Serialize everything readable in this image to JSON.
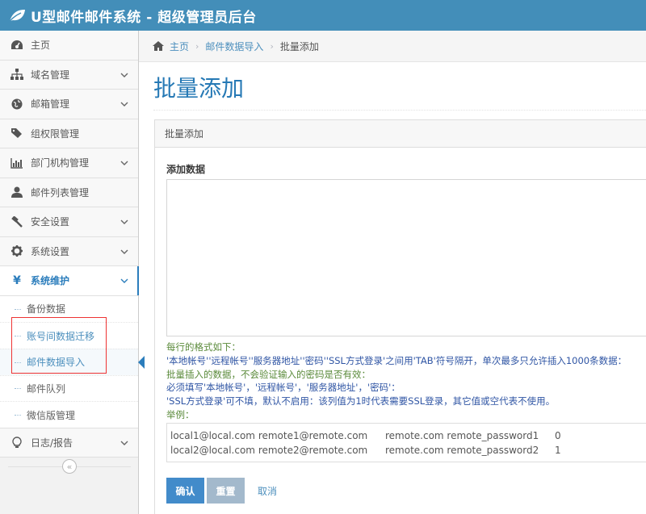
{
  "app": {
    "title": "U型邮件邮件系统 - 超级管理员后台"
  },
  "sidebar": {
    "items": [
      {
        "label": "主页",
        "icon": "dashboard-icon",
        "caret": false
      },
      {
        "label": "域名管理",
        "icon": "sitemap-icon",
        "caret": true
      },
      {
        "label": "邮箱管理",
        "icon": "globe-icon",
        "caret": true
      },
      {
        "label": "组权限管理",
        "icon": "tags-icon",
        "caret": false
      },
      {
        "label": "部门机构管理",
        "icon": "bar-chart-icon",
        "caret": true
      },
      {
        "label": "邮件列表管理",
        "icon": "user-icon",
        "caret": false
      },
      {
        "label": "安全设置",
        "icon": "gavel-icon",
        "caret": true
      },
      {
        "label": "系统设置",
        "icon": "cog-icon",
        "caret": true
      },
      {
        "label": "系统维护",
        "icon": "yen-icon",
        "caret": true,
        "active": true
      }
    ],
    "submenu": [
      {
        "label": "备份数据"
      },
      {
        "label": "账号间数据迁移",
        "highlight": true
      },
      {
        "label": "邮件数据导入",
        "highlight": true,
        "current": true
      },
      {
        "label": "邮件队列"
      },
      {
        "label": "微信版管理"
      }
    ],
    "last_item": {
      "label": "日志/报告",
      "icon": "lightbulb-icon",
      "caret": true
    },
    "collapse_glyph": "«"
  },
  "breadcrumb": {
    "home": "主页",
    "parent": "邮件数据导入",
    "current": "批量添加",
    "sep": "›"
  },
  "page": {
    "title": "批量添加"
  },
  "widget": {
    "header": "批量添加",
    "field_label": "添加数据",
    "textarea_value": ""
  },
  "hints": {
    "line1": "每行的格式如下：",
    "line2": "'本地帐号''远程帐号''服务器地址''密码''SSL方式登录'之间用'TAB'符号隔开，单次最多只允许插入1000条数据：",
    "line3": "批量插入的数据，不会验证输入的密码是否有效：",
    "line4": "必须填写'本地帐号'，'远程帐号'，'服务器地址'，'密码'：",
    "line5": "'SSL方式登录'可不填，默认不启用：该列值为1时代表需要SSL登录，其它值或空代表不使用。",
    "line6": "举例："
  },
  "example": {
    "rows": [
      {
        "accounts": "local1@local.com remote1@remote.com",
        "server_password": "remote.com  remote_password1",
        "ssl": "0"
      },
      {
        "accounts": "local2@local.com remote2@remote.com",
        "server_password": "remote.com  remote_password2",
        "ssl": "1"
      }
    ]
  },
  "buttons": {
    "ok": "确认",
    "reset": "重置",
    "cancel": "取消"
  },
  "colors": {
    "navbar": "#438eb9",
    "accent": "#2b7dbc",
    "title": "#2679b5",
    "annotation_box": "#ee3333"
  }
}
